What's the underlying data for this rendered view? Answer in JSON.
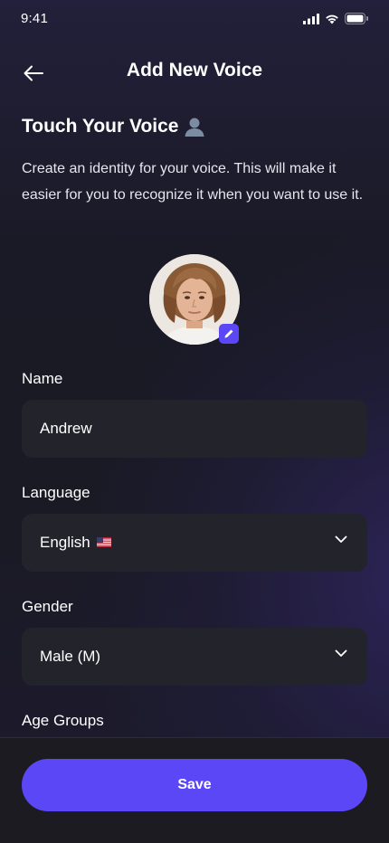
{
  "status_bar": {
    "time": "9:41",
    "icons": [
      "signal-icon",
      "wifi-icon",
      "battery-icon"
    ]
  },
  "header": {
    "title": "Add New Voice",
    "back_icon": "arrow-left-icon"
  },
  "intro": {
    "title": "Touch Your Voice",
    "title_icon": "user-silhouette-icon",
    "description": "Create an identity for your voice. This will make it easier for you to recognize it when you want to use it."
  },
  "avatar": {
    "edit_icon": "pencil-icon"
  },
  "form": {
    "name": {
      "label": "Name",
      "value": "Andrew"
    },
    "language": {
      "label": "Language",
      "value": "English",
      "flag_icon": "us-flag-icon"
    },
    "gender": {
      "label": "Gender",
      "value": "Male (M)"
    },
    "age_groups": {
      "label": "Age Groups"
    }
  },
  "footer": {
    "save_label": "Save"
  },
  "colors": {
    "accent": "#5b47f5",
    "field_bg": "#22232b",
    "background": "#1a1a24"
  }
}
